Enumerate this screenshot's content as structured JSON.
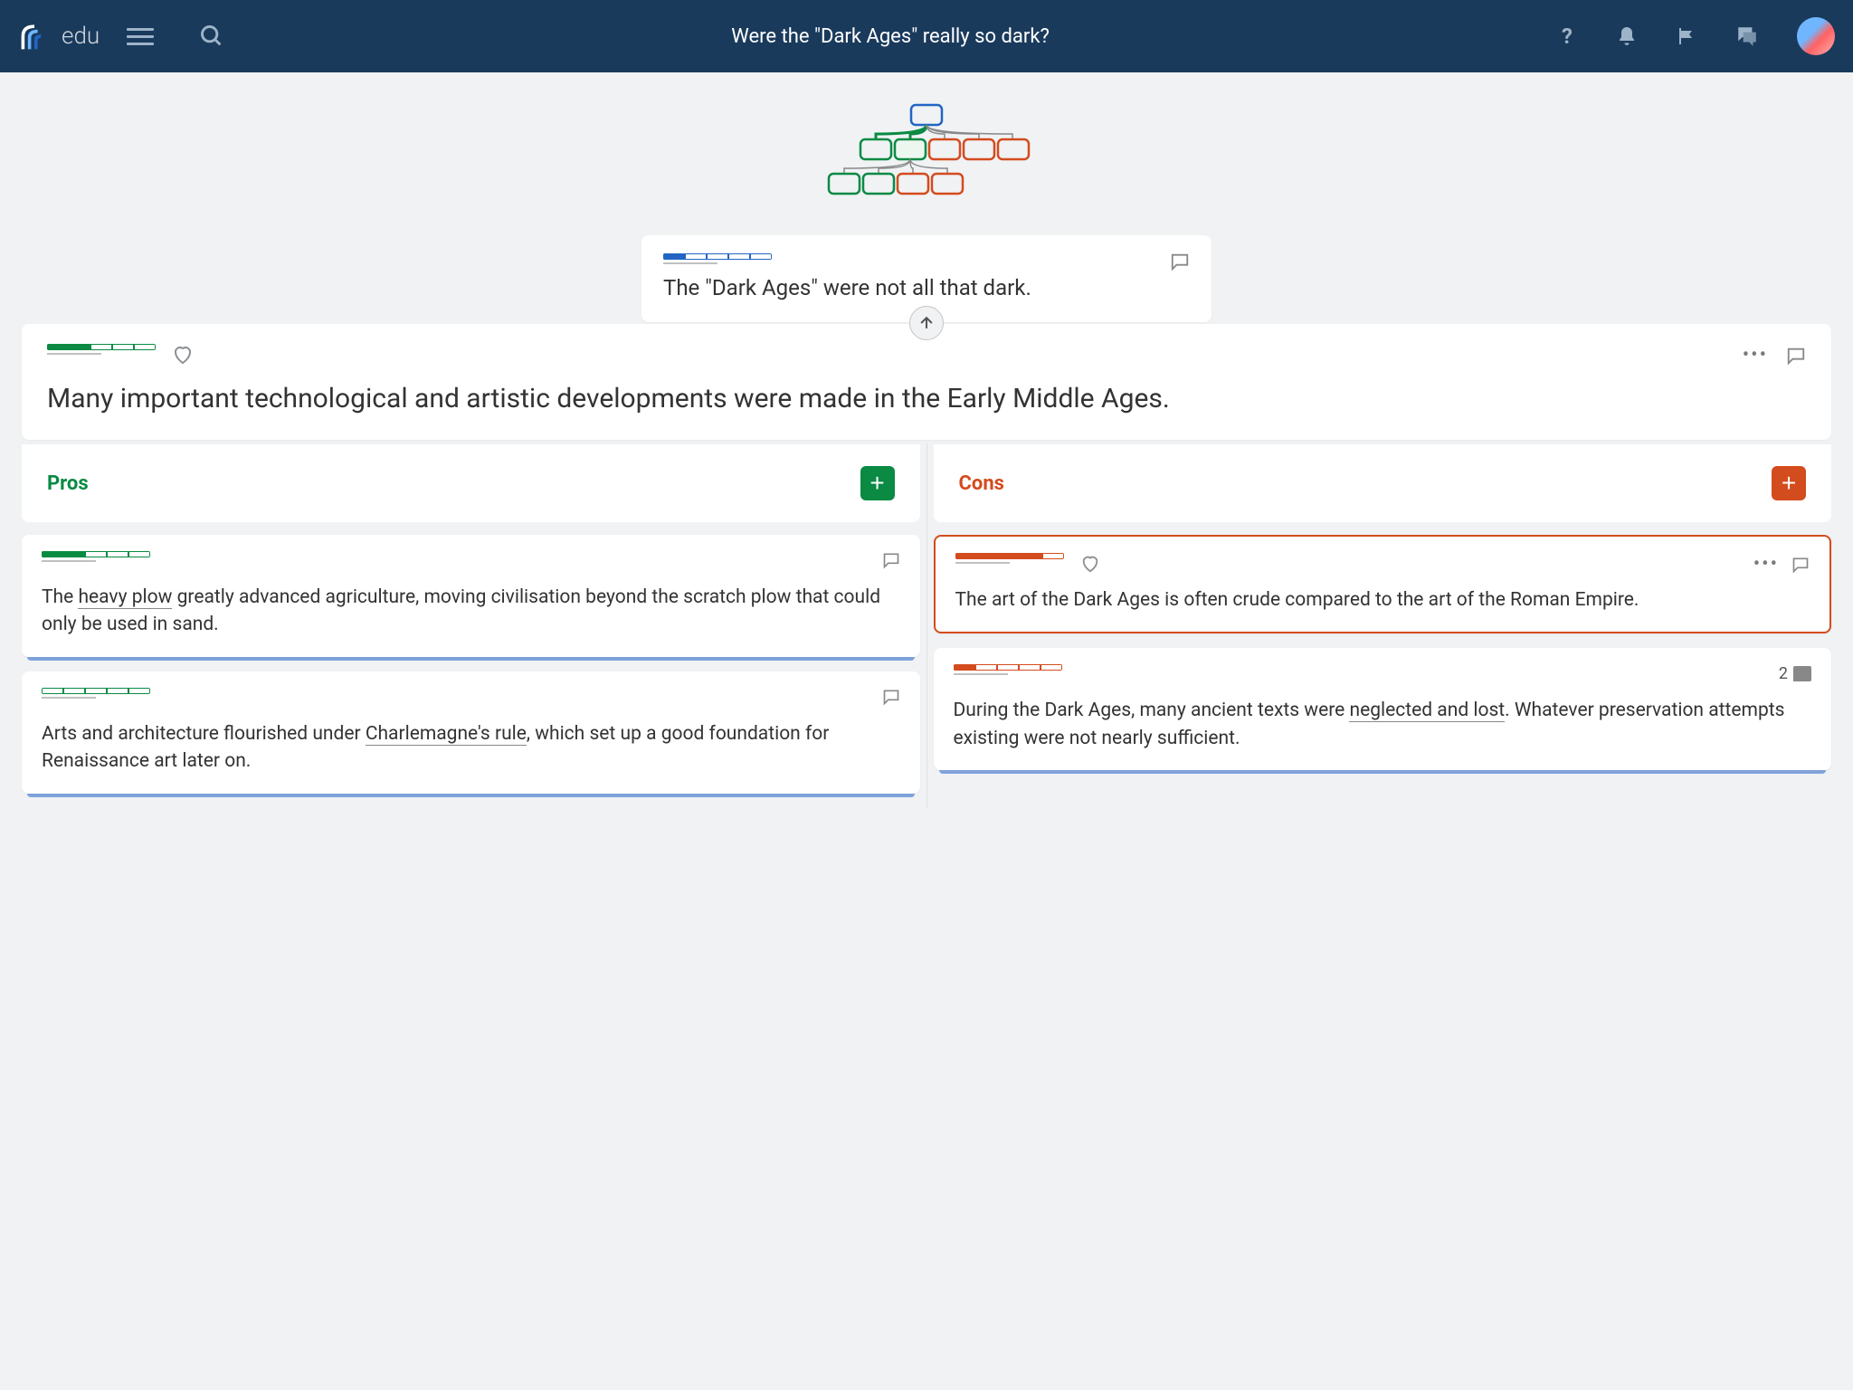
{
  "header": {
    "brand": "edu",
    "title": "Were the \"Dark Ages\" really so dark?"
  },
  "thesis": {
    "text": "The \"Dark Ages\" were not all that dark."
  },
  "main_claim": {
    "text": "Many important technological and artistic developments were made in the Early Middle Ages."
  },
  "columns": {
    "pros_label": "Pros",
    "cons_label": "Cons"
  },
  "pros": [
    {
      "text_pre": "The ",
      "link1": "heavy plow",
      "text_post": " greatly advanced agriculture, moving civilisation beyond the scratch plow that could only be used in sand."
    },
    {
      "text_pre": "Arts and architecture flourished under ",
      "link1": "Charlemagne's rule",
      "text_post": ", which set up a good foundation for Renaissance art later on."
    }
  ],
  "cons": [
    {
      "text": "The art of the Dark Ages is often crude compared to the art of the Roman Empire.",
      "selected": true
    },
    {
      "text_pre": "During the Dark Ages, many ancient texts were ",
      "link1": "neglected and lost",
      "text_post": ". Whatever preservation attempts existing were not nearly sufficient.",
      "comment_count": "2"
    }
  ]
}
